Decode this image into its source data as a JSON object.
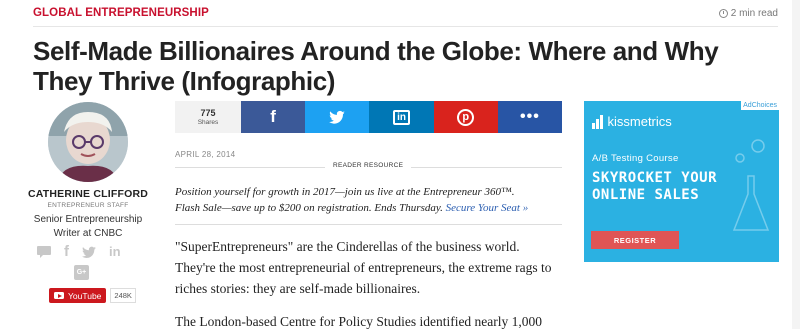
{
  "header": {
    "category": "GLOBAL ENTREPRENEURSHIP",
    "read_time": "2 min read"
  },
  "article": {
    "title": "Self-Made Billionaires Around the Globe: Where and Why They Thrive (Infographic)",
    "date": "APRIL 28, 2014",
    "resource_label": "READER RESOURCE",
    "promo_line1": "Position yourself for growth in 2017—join us live at the Entrepreneur 360™.",
    "promo_line2_prefix": "Flash Sale—save up to $200 on registration. Ends Thursday.",
    "promo_link": "Secure Your Seat »",
    "paragraph1": "\"SuperEntrepreneurs\" are the Cinderellas of the business world. They're the most entrepreneurial of entrepreneurs, the extreme rags to riches stories: they are self-made billionaires.",
    "paragraph2": "The London-based Centre for Policy Studies identified nearly 1,000"
  },
  "author": {
    "name": "CATHERINE CLIFFORD",
    "role": "ENTREPRENEUR STAFF",
    "title": "Senior Entrepreneurship Writer at CNBC",
    "gplus": "G+",
    "youtube_label": "YouTube",
    "youtube_count": "248K"
  },
  "share": {
    "count": "775",
    "count_label": "Shares",
    "facebook": "f",
    "linkedin": "in",
    "pinterest": "p",
    "more": "•••",
    "colors": {
      "facebook": "#3b5998",
      "twitter": "#1da1f2",
      "linkedin": "#0077b5",
      "pinterest": "#d9231d",
      "more": "#2855a5"
    }
  },
  "ad": {
    "adchoices": "AdChoices",
    "brand": "kissmetrics",
    "subtitle": "A/B Testing Course",
    "headline_line1": "SKYROCKET YOUR",
    "headline_line2": "ONLINE SALES",
    "button": "REGISTER",
    "background": "#2bb1e2"
  },
  "accent_color": "#c8102e"
}
